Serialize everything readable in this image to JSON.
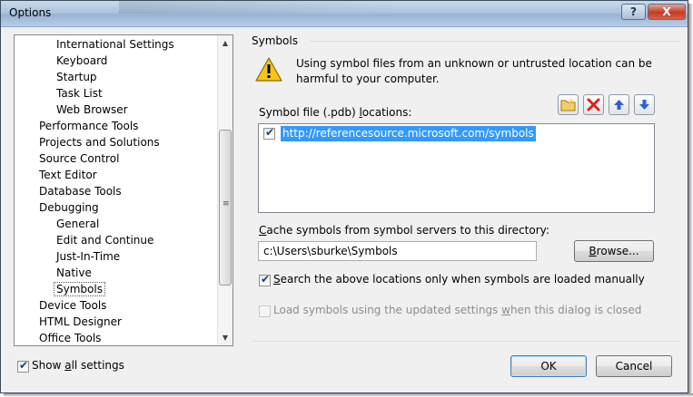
{
  "window": {
    "title": "Options",
    "help_glyph": "?",
    "close_glyph": "X"
  },
  "tree": {
    "items": [
      {
        "label": "International Settings",
        "level": 2
      },
      {
        "label": "Keyboard",
        "level": 2
      },
      {
        "label": "Startup",
        "level": 2
      },
      {
        "label": "Task List",
        "level": 2
      },
      {
        "label": "Web Browser",
        "level": 2
      },
      {
        "label": "Performance Tools",
        "level": 1
      },
      {
        "label": "Projects and Solutions",
        "level": 1
      },
      {
        "label": "Source Control",
        "level": 1
      },
      {
        "label": "Text Editor",
        "level": 1
      },
      {
        "label": "Database Tools",
        "level": 1
      },
      {
        "label": "Debugging",
        "level": 1
      },
      {
        "label": "General",
        "level": 2
      },
      {
        "label": "Edit and Continue",
        "level": 2
      },
      {
        "label": "Just-In-Time",
        "level": 2
      },
      {
        "label": "Native",
        "level": 2
      },
      {
        "label": "Symbols",
        "level": 2,
        "selected": true
      },
      {
        "label": "Device Tools",
        "level": 1
      },
      {
        "label": "HTML Designer",
        "level": 1
      },
      {
        "label": "Office Tools",
        "level": 1
      }
    ]
  },
  "page": {
    "group_title": "Symbols",
    "warning_text": "Using symbol files from an unknown or untrusted location can be harmful to your computer.",
    "locations_label_pre": "Symbol file (.pdb) ",
    "locations_label_key": "l",
    "locations_label_post": "ocations:",
    "locations": [
      {
        "url": "http://referencesource.microsoft.com/symbols",
        "checked": true
      }
    ],
    "cache_label_key": "C",
    "cache_label_rest": "ache symbols from symbol servers to this directory:",
    "cache_path": "c:\\Users\\sburke\\Symbols",
    "browse_key": "B",
    "browse_rest": "rowse...",
    "search_manual_key": "S",
    "search_manual_rest": "earch the above locations only when symbols are loaded manually",
    "search_manual_checked": true,
    "load_updated_pre": "Load symbols using the updated settings ",
    "load_updated_key": "w",
    "load_updated_post": "hen this dialog is closed",
    "load_updated_checked": false,
    "load_updated_enabled": false
  },
  "footer": {
    "show_all_pre": "Show ",
    "show_all_key": "a",
    "show_all_post": "ll settings",
    "show_all_checked": true,
    "ok_label": "OK",
    "cancel_label": "Cancel"
  },
  "icons": [
    "folder-icon",
    "delete-icon",
    "move-up-icon",
    "move-down-icon",
    "warning-icon"
  ],
  "colors": {
    "selection": "#3399ff",
    "delete_red": "#e0201b",
    "arrow_blue": "#2a62d6",
    "warning_yellow": "#f7c51a"
  }
}
